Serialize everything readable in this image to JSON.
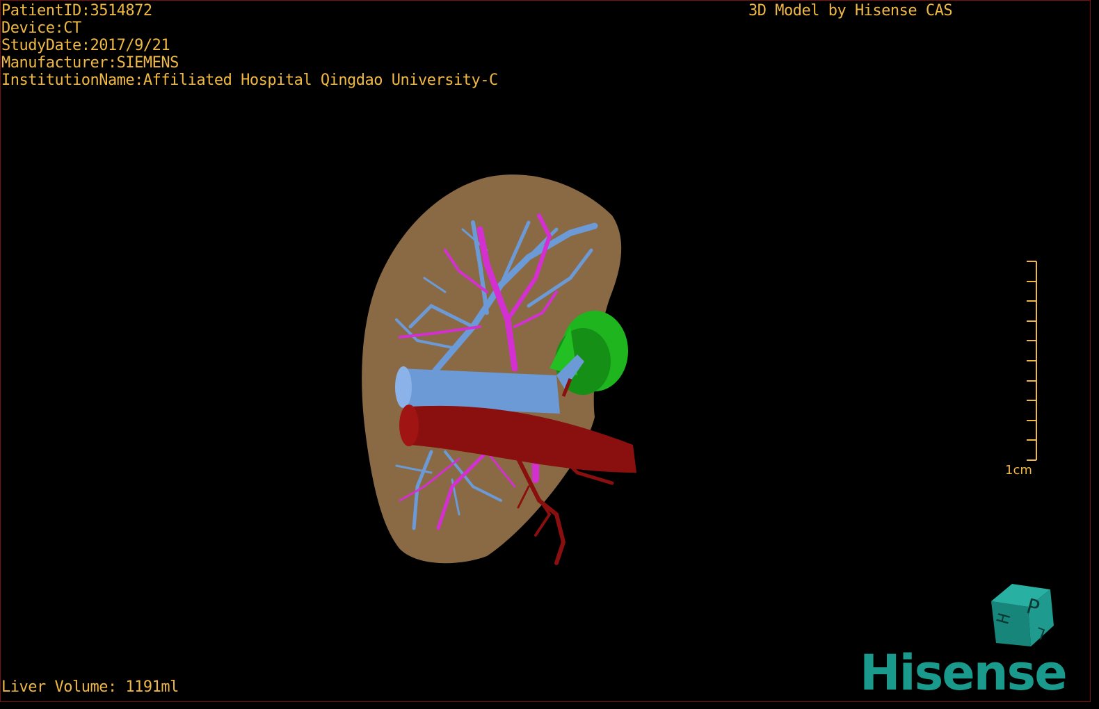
{
  "dicom": {
    "patient_id": "PatientID:3514872",
    "device": "Device:CT",
    "study_date": "StudyDate:2017/9/21",
    "manufacturer": "Manufacturer:SIEMENS",
    "institution": "InstitutionName:Affiliated Hospital Qingdao University-C"
  },
  "header_right": "3D Model by Hisense CAS",
  "liver_volume": "Liver Volume: 1191ml",
  "scale_bar": {
    "label": "1cm"
  },
  "orientation_cube": {
    "faces": [
      "P",
      "H",
      "L"
    ],
    "color": "#1a8a80"
  },
  "brand": "Hisense",
  "colors": {
    "text": "#f0b844",
    "liver": "#8a6a45",
    "portal_vein": "#6c9ad6",
    "hepatic_vein": "#d42fd0",
    "artery": "#8a0f0f",
    "green_structure": "#18a81a",
    "brand": "#1a9a8c"
  }
}
